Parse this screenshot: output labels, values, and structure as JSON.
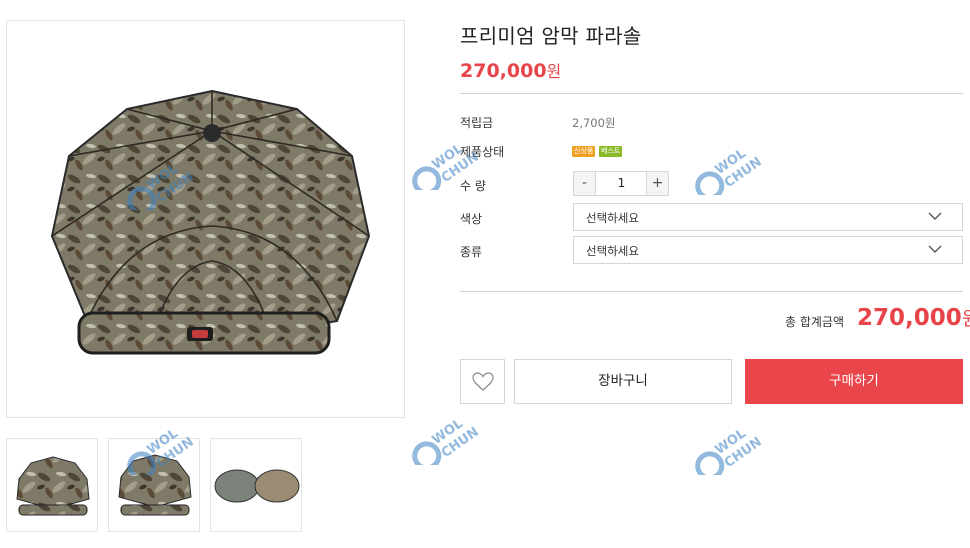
{
  "product": {
    "title": "프리미엄 암막 파라솔",
    "price_number": "270,000",
    "price_unit": "원"
  },
  "details": {
    "points_label": "적립금",
    "points_value": "2,700원",
    "status_label": "제품상태",
    "status_badges": [
      "신상품",
      "베스트"
    ],
    "quantity_label": "수 량",
    "quantity_value": "1",
    "minus_label": "-",
    "plus_label": "+",
    "color_label": "색상",
    "color_selected": "선택하세요",
    "type_label": "종류",
    "type_selected": "선택하세요"
  },
  "total": {
    "label": "총 합계금액",
    "number": "270,000",
    "unit": "원"
  },
  "actions": {
    "cart_label": "장바구니",
    "buy_label": "구매하기",
    "wish_icon": "heart-icon"
  },
  "colors": {
    "accent": "#e9454b",
    "badge_new": "#f2a022",
    "badge_best": "#8bb92a"
  }
}
